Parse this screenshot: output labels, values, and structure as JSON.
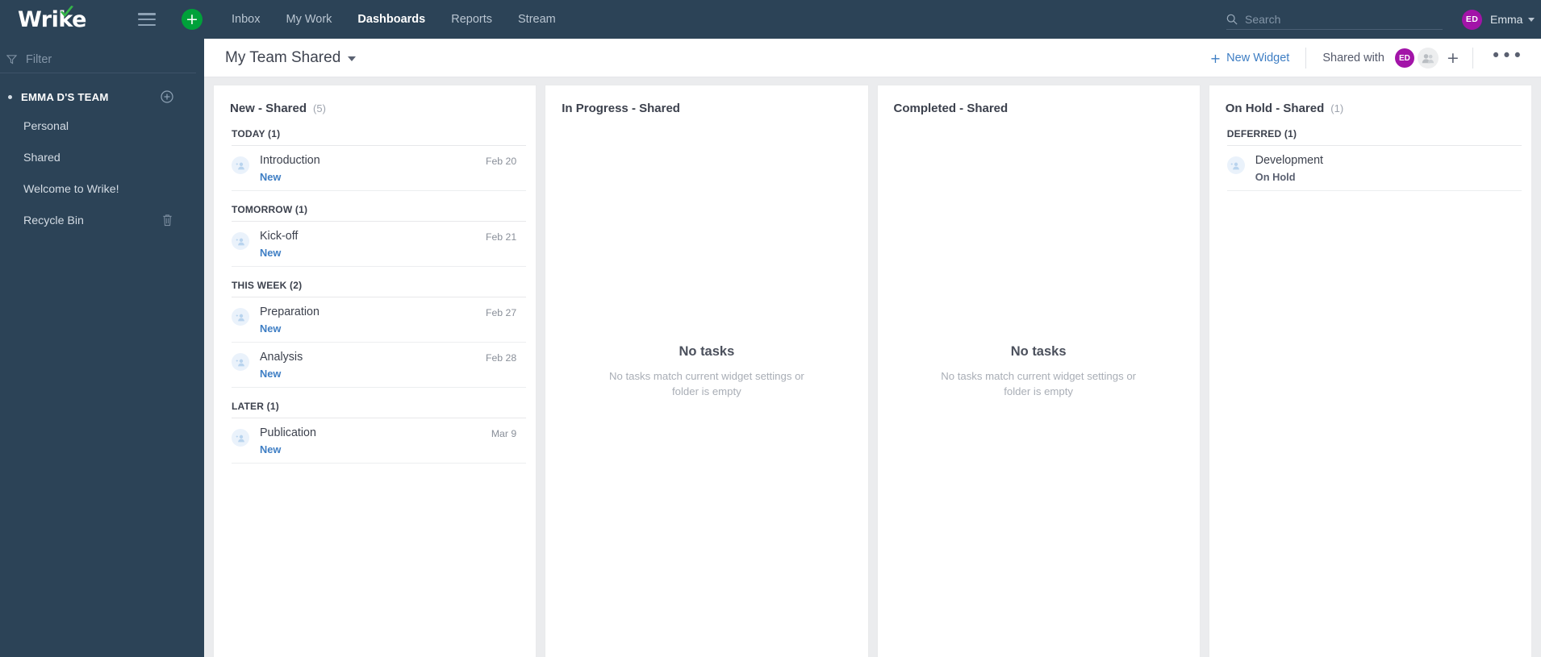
{
  "brand": {
    "name": "Wrike",
    "logo_accent": "#36b54a",
    "topbar_bg": "#2c4357"
  },
  "topbar": {
    "menu_icon": "hamburger-icon",
    "create_label": "+",
    "nav": [
      {
        "label": "Inbox",
        "active": false
      },
      {
        "label": "My Work",
        "active": false
      },
      {
        "label": "Dashboards",
        "active": true
      },
      {
        "label": "Reports",
        "active": false
      },
      {
        "label": "Stream",
        "active": false
      }
    ],
    "search": {
      "placeholder": "Search",
      "value": "",
      "icon": "search-icon"
    },
    "user": {
      "initials": "ED",
      "name": "Emma",
      "avatar_color": "#a214a8"
    }
  },
  "sidebar": {
    "filter": {
      "placeholder": "Filter",
      "value": "",
      "icon": "filter-funnel-icon"
    },
    "team": {
      "label": "EMMA D'S TEAM",
      "add_icon": "add-circle-icon"
    },
    "items": [
      {
        "label": "Personal"
      },
      {
        "label": "Shared"
      },
      {
        "label": "Welcome to Wrike!"
      },
      {
        "label": "Recycle Bin",
        "icon": "trash-icon"
      }
    ]
  },
  "dashboard": {
    "title": "My Team Shared",
    "new_widget_label": "New Widget",
    "new_widget_plus": "+",
    "shared_with_label": "Shared with",
    "shared_avatar": {
      "initials": "ED",
      "color": "#a214a8"
    },
    "group_avatar_icon": "people-icon",
    "add_person_label": "+",
    "more_menu_label": "•••",
    "accent_link": "#3e7ec4"
  },
  "widgets": [
    {
      "title": "New - Shared",
      "count": "(5)",
      "empty": false,
      "groups": [
        {
          "label": "TODAY (1)",
          "tasks": [
            {
              "name": "Introduction",
              "status": "New",
              "date": "Feb 20",
              "avatar_icon": "assign-user-icon"
            }
          ]
        },
        {
          "label": "TOMORROW (1)",
          "tasks": [
            {
              "name": "Kick-off",
              "status": "New",
              "date": "Feb 21",
              "avatar_icon": "assign-user-icon"
            }
          ]
        },
        {
          "label": "THIS WEEK (2)",
          "tasks": [
            {
              "name": "Preparation",
              "status": "New",
              "date": "Feb 27",
              "avatar_icon": "assign-user-icon"
            },
            {
              "name": "Analysis",
              "status": "New",
              "date": "Feb 28",
              "avatar_icon": "assign-user-icon"
            }
          ]
        },
        {
          "label": "LATER (1)",
          "tasks": [
            {
              "name": "Publication",
              "status": "New",
              "date": "Mar 9",
              "avatar_icon": "assign-user-icon"
            }
          ]
        }
      ]
    },
    {
      "title": "In Progress - Shared",
      "count": "",
      "empty": true,
      "empty_title": "No tasks",
      "empty_sub": "No tasks match current widget settings or folder is empty",
      "groups": []
    },
    {
      "title": "Completed - Shared",
      "count": "",
      "empty": true,
      "empty_title": "No tasks",
      "empty_sub": "No tasks match current widget settings or folder is empty",
      "groups": []
    },
    {
      "title": "On Hold - Shared",
      "count": "(1)",
      "empty": false,
      "groups": [
        {
          "label": "DEFERRED (1)",
          "tasks": [
            {
              "name": "Development",
              "status": "On Hold",
              "date": "",
              "avatar_icon": "assign-user-icon",
              "status_muted": true
            }
          ]
        }
      ]
    }
  ]
}
